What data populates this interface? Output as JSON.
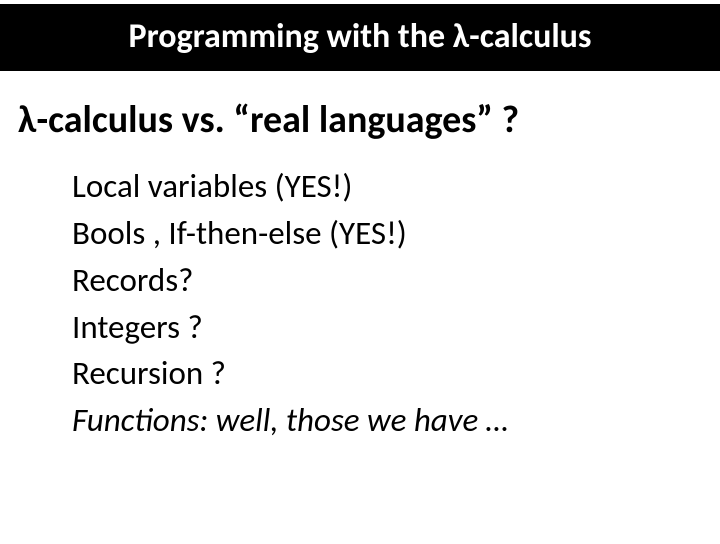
{
  "title": "Programming with the λ-calculus",
  "subtitle": "λ-calculus vs. “real languages” ?",
  "items": [
    {
      "text": "Local variables (YES!)",
      "italic": false
    },
    {
      "text": "Bools , If-then-else (YES!)",
      "italic": false
    },
    {
      "text": "Records?",
      "italic": false
    },
    {
      "text": "Integers ?",
      "italic": false
    },
    {
      "text": "Recursion ?",
      "italic": false
    },
    {
      "text": "Functions: well, those we have …",
      "italic": true
    }
  ]
}
